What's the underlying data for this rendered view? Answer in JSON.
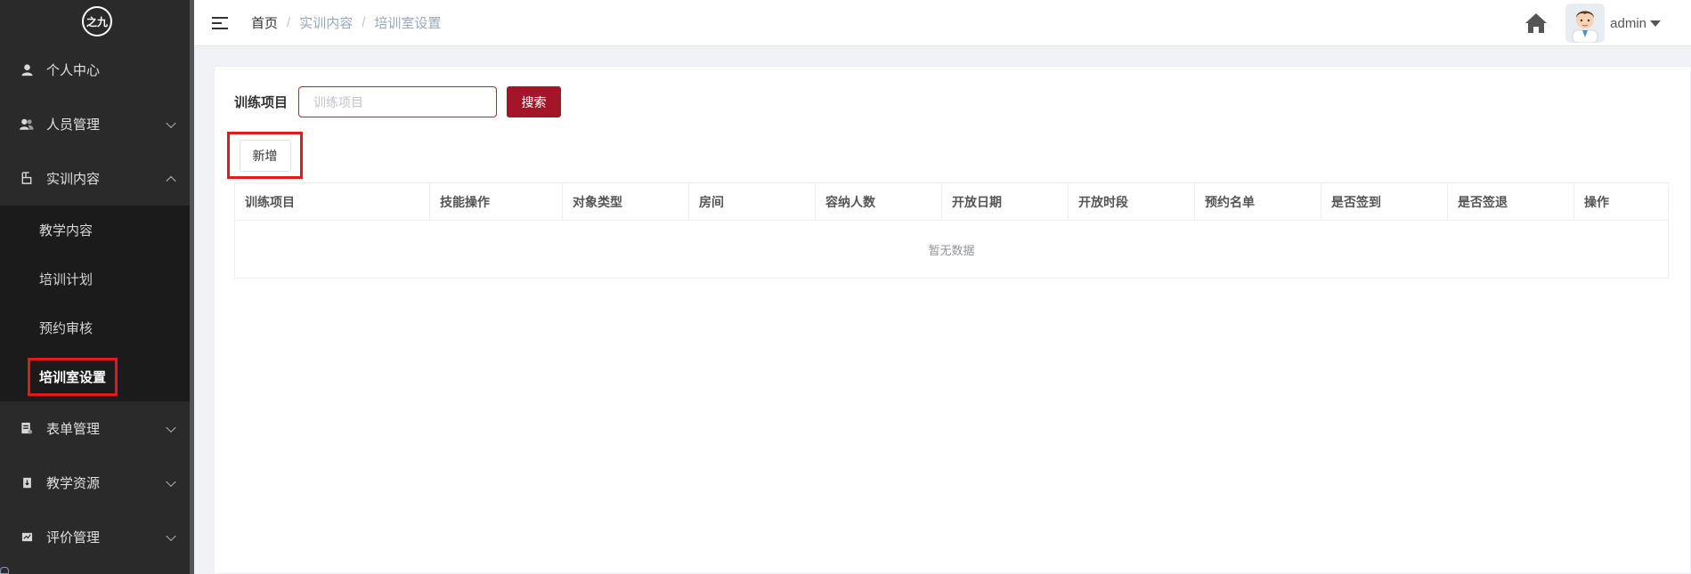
{
  "sidebar": {
    "logo_text": "之九",
    "items": [
      {
        "label": "个人中心",
        "icon": "person-icon",
        "expandable": false
      },
      {
        "label": "人员管理",
        "icon": "users-icon",
        "expandable": true
      },
      {
        "label": "实训内容",
        "icon": "content-icon",
        "expandable": true,
        "expanded": true
      }
    ],
    "submenu": [
      {
        "label": "教学内容"
      },
      {
        "label": "培训计划"
      },
      {
        "label": "预约审核"
      },
      {
        "label": "培训室设置",
        "active": true
      }
    ],
    "items_after": [
      {
        "label": "表单管理",
        "icon": "form-icon"
      },
      {
        "label": "教学资源",
        "icon": "resource-icon"
      },
      {
        "label": "评价管理",
        "icon": "evaluation-icon"
      }
    ]
  },
  "header": {
    "breadcrumb": [
      "首页",
      "实训内容",
      "培训室设置"
    ],
    "separator": "/",
    "user_name": "admin"
  },
  "search": {
    "label": "训练项目",
    "placeholder": "训练项目",
    "button_label": "搜索"
  },
  "toolbar": {
    "add_label": "新增"
  },
  "table": {
    "columns": [
      "训练项目",
      "技能操作",
      "对象类型",
      "房间",
      "容纳人数",
      "开放日期",
      "开放时段",
      "预约名单",
      "是否签到",
      "是否签退",
      "操作"
    ],
    "empty_text": "暂无数据"
  },
  "colors": {
    "sidebar_bg": "#2a2a2a",
    "submenu_bg": "#1b1b1b",
    "primary": "#a3162a",
    "highlight_box": "#e01b1b"
  }
}
